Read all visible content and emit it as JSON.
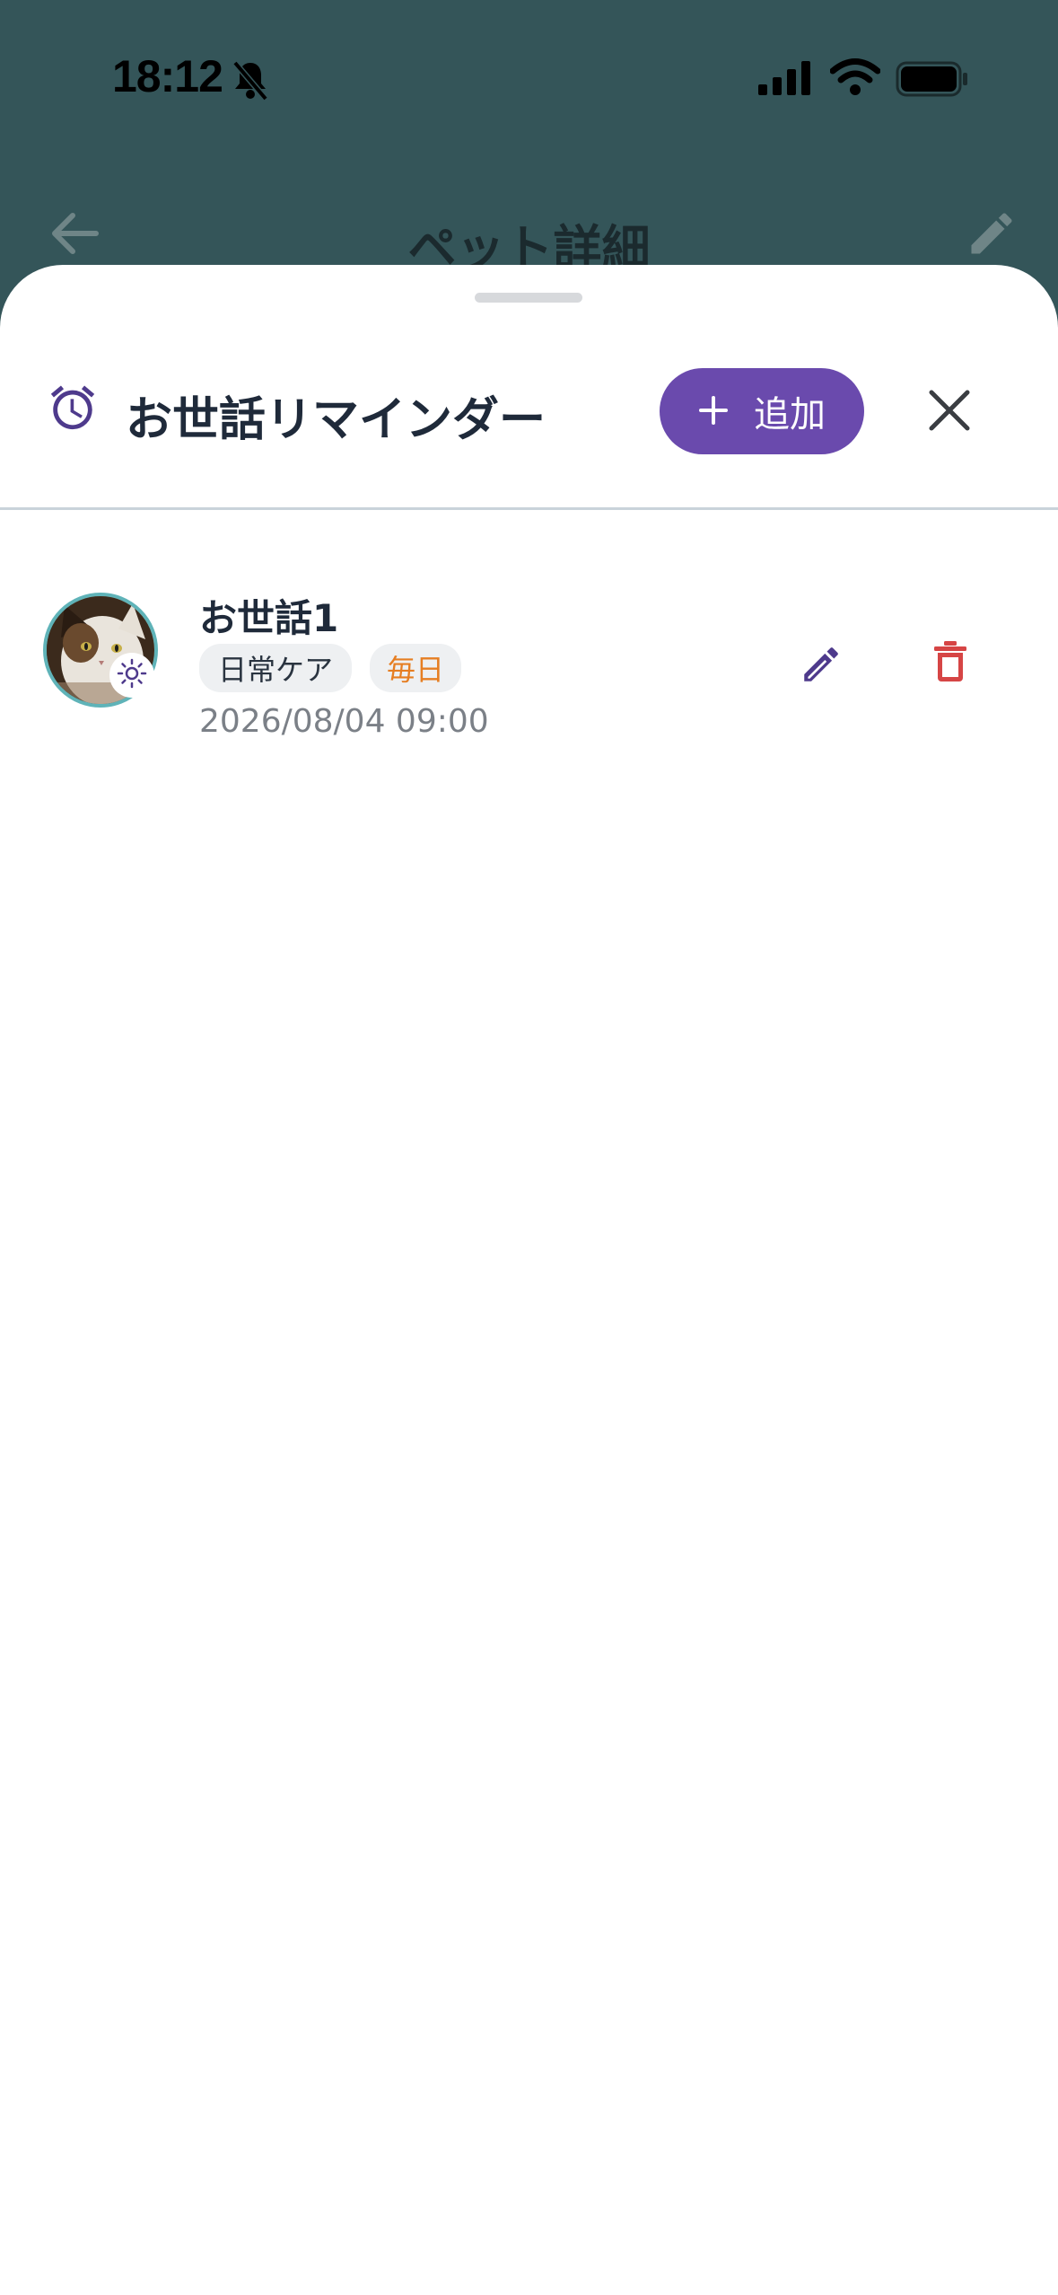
{
  "status_bar": {
    "time": "18:12"
  },
  "app_bar": {
    "title": "ペット詳細"
  },
  "sheet": {
    "title": "お世話リマインダー",
    "add_label": "追加"
  },
  "reminders": [
    {
      "title": "お世話1",
      "category": "日常ケア",
      "frequency": "毎日",
      "datetime": "2026/08/04 09:00"
    }
  ],
  "colors": {
    "header_bg": "#345559",
    "accent": "#6a4aad",
    "delete": "#d64545",
    "frequency_text": "#e67e22"
  }
}
